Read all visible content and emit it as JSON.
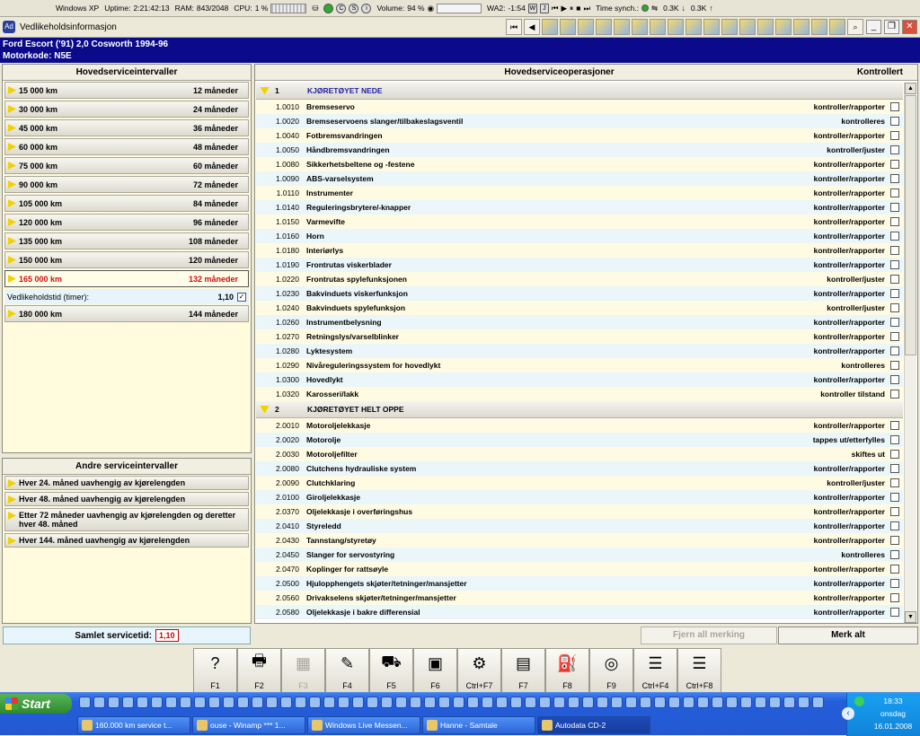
{
  "sysbar": {
    "os": "Windows XP",
    "uptime_label": "Uptime:",
    "uptime": "2:21:42:13",
    "ram_label": "RAM:",
    "ram": "843/2048",
    "cpu_label": "CPU:",
    "cpu": "1 %",
    "volume_label": "Volume:",
    "volume": "94 %",
    "wa2_label": "WA2:",
    "wa2_time": "-1:54",
    "wa2_buttons": [
      "W",
      "J"
    ],
    "timesync_label": "Time synch.:",
    "down": "0.3K",
    "up": "0.3K"
  },
  "window": {
    "title": "Vedlikeholdsinformasjon",
    "app_icon_text": "Ad"
  },
  "car": {
    "line1": "Ford   Escort ('91) 2,0 Cosworth 1994-96",
    "line2": "Motorkode: N5E"
  },
  "left": {
    "title": "Hovedserviceintervaller",
    "intervals": [
      {
        "km": "15 000 km",
        "months": "12 måneder"
      },
      {
        "km": "30 000 km",
        "months": "24 måneder"
      },
      {
        "km": "45 000 km",
        "months": "36 måneder"
      },
      {
        "km": "60 000 km",
        "months": "48 måneder"
      },
      {
        "km": "75 000 km",
        "months": "60 måneder"
      },
      {
        "km": "90 000 km",
        "months": "72 måneder"
      },
      {
        "km": "105 000 km",
        "months": "84 måneder"
      },
      {
        "km": "120 000 km",
        "months": "96 måneder"
      },
      {
        "km": "135 000 km",
        "months": "108 måneder"
      },
      {
        "km": "150 000 km",
        "months": "120 måneder"
      },
      {
        "km": "165 000 km",
        "months": "132 måneder"
      },
      {
        "km": "180 000 km",
        "months": "144 måneder"
      }
    ],
    "selected_index": 10,
    "maint_time_label": "Vedlikeholdstid (timer):",
    "maint_time_value": "1,10",
    "maint_check": "✓"
  },
  "other": {
    "title": "Andre serviceintervaller",
    "items": [
      "Hver 24. måned uavhengig av kjørelengden",
      "Hver 48. måned uavhengig av kjørelengden",
      "Etter 72 måneder uavhengig av kjørelengden og deretter hver 48. måned",
      "Hver 144. måned uavhengig av kjørelengden"
    ]
  },
  "right": {
    "title": "Hovedserviceoperasjoner",
    "checked_label": "Kontrollert",
    "groups": [
      {
        "num": "1",
        "title": "KJØRETØYET NEDE",
        "ops": [
          {
            "code": "1.0010",
            "name": "Bremseservo",
            "status": "kontroller/rapporter"
          },
          {
            "code": "1.0020",
            "name": "Bremseservoens slanger/tilbakeslagsventil",
            "status": "kontrolleres"
          },
          {
            "code": "1.0040",
            "name": "Fotbremsvandringen",
            "status": "kontroller/rapporter"
          },
          {
            "code": "1.0050",
            "name": "Håndbremsvandringen",
            "status": "kontroller/juster"
          },
          {
            "code": "1.0080",
            "name": "Sikkerhetsbeltene og -festene",
            "status": "kontroller/rapporter"
          },
          {
            "code": "1.0090",
            "name": "ABS-varselsystem",
            "status": "kontroller/rapporter"
          },
          {
            "code": "1.0110",
            "name": "Instrumenter",
            "status": "kontroller/rapporter"
          },
          {
            "code": "1.0140",
            "name": "Reguleringsbrytere/-knapper",
            "status": "kontroller/rapporter"
          },
          {
            "code": "1.0150",
            "name": "Varmevifte",
            "status": "kontroller/rapporter"
          },
          {
            "code": "1.0160",
            "name": "Horn",
            "status": "kontroller/rapporter"
          },
          {
            "code": "1.0180",
            "name": "Interiørlys",
            "status": "kontroller/rapporter"
          },
          {
            "code": "1.0190",
            "name": "Frontrutas viskerblader",
            "status": "kontroller/rapporter"
          },
          {
            "code": "1.0220",
            "name": "Frontrutas spylefunksjonen",
            "status": "kontroller/juster"
          },
          {
            "code": "1.0230",
            "name": "Bakvinduets viskerfunksjon",
            "status": "kontroller/rapporter"
          },
          {
            "code": "1.0240",
            "name": "Bakvinduets spylefunksjon",
            "status": "kontroller/juster"
          },
          {
            "code": "1.0260",
            "name": "Instrumentbelysning",
            "status": "kontroller/rapporter"
          },
          {
            "code": "1.0270",
            "name": "Retningslys/varselblinker",
            "status": "kontroller/rapporter"
          },
          {
            "code": "1.0280",
            "name": "Lyktesystem",
            "status": "kontroller/rapporter"
          },
          {
            "code": "1.0290",
            "name": "Nivåreguleringssystem for hovedlykt",
            "status": "kontrolleres"
          },
          {
            "code": "1.0300",
            "name": "Hovedlykt",
            "status": "kontroller/rapporter"
          },
          {
            "code": "1.0320",
            "name": "Karosseri/lakk",
            "status": "kontroller tilstand"
          }
        ]
      },
      {
        "num": "2",
        "title": "KJØRETØYET HELT OPPE",
        "ops": [
          {
            "code": "2.0010",
            "name": "Motoroljelekkasje",
            "status": "kontroller/rapporter"
          },
          {
            "code": "2.0020",
            "name": "Motorolje",
            "status": "tappes ut/etterfylles"
          },
          {
            "code": "2.0030",
            "name": "Motoroljefilter",
            "status": "skiftes ut"
          },
          {
            "code": "2.0080",
            "name": "Clutchens hydrauliske system",
            "status": "kontroller/rapporter"
          },
          {
            "code": "2.0090",
            "name": "Clutchklaring",
            "status": "kontroller/juster"
          },
          {
            "code": "2.0100",
            "name": "Giroljelekkasje",
            "status": "kontroller/rapporter"
          },
          {
            "code": "2.0370",
            "name": "Oljelekkasje i overføringshus",
            "status": "kontroller/rapporter"
          },
          {
            "code": "2.0410",
            "name": "Styreledd",
            "status": "kontroller/rapporter"
          },
          {
            "code": "2.0430",
            "name": "Tannstang/styretøy",
            "status": "kontroller/rapporter"
          },
          {
            "code": "2.0450",
            "name": "Slanger for servostyring",
            "status": "kontrolleres"
          },
          {
            "code": "2.0470",
            "name": "Koplinger for rattsøyle",
            "status": "kontroller/rapporter"
          },
          {
            "code": "2.0500",
            "name": "Hjulopphengets skjøter/tetninger/mansjetter",
            "status": "kontroller/rapporter"
          },
          {
            "code": "2.0560",
            "name": "Drivakselens skjøter/tetninger/mansjetter",
            "status": "kontroller/rapporter"
          },
          {
            "code": "2.0580",
            "name": "Oljelekkasje i bakre differensial",
            "status": "kontroller/rapporter"
          }
        ]
      }
    ]
  },
  "bottom": {
    "total_label": "Samlet servicetid:",
    "total_value": "1,10",
    "clear_all": "Fjern all merking",
    "mark_all": "Merk alt"
  },
  "fkeys": [
    {
      "label": "F1",
      "icon": "?"
    },
    {
      "label": "F2",
      "icon": "🖶"
    },
    {
      "label": "F3",
      "icon": "▦"
    },
    {
      "label": "F4",
      "icon": "✎"
    },
    {
      "label": "F5",
      "icon": "⛟"
    },
    {
      "label": "F6",
      "icon": "▣"
    },
    {
      "label": "Ctrl+F7",
      "icon": "⚙"
    },
    {
      "label": "F7",
      "icon": "▤"
    },
    {
      "label": "F8",
      "icon": "⛽"
    },
    {
      "label": "F9",
      "icon": "◎"
    },
    {
      "label": "Ctrl+F4",
      "icon": "☰"
    },
    {
      "label": "Ctrl+F8",
      "icon": "☰"
    }
  ],
  "taskbar": {
    "start": "Start",
    "tasks": [
      "160.000 km service t...",
      "ouse - Winamp *** 1...",
      "Windows Live Messen...",
      "Hanne - Samtale",
      "Autodata CD-2"
    ],
    "time": "18:33",
    "day": "onsdag",
    "date": "16.01.2008"
  },
  "colors": {
    "title_blue": "#0a0a8a",
    "selected_red": "#d01010",
    "row_blue": "#eaf6fa",
    "row_yellow": "#fffbe3"
  }
}
